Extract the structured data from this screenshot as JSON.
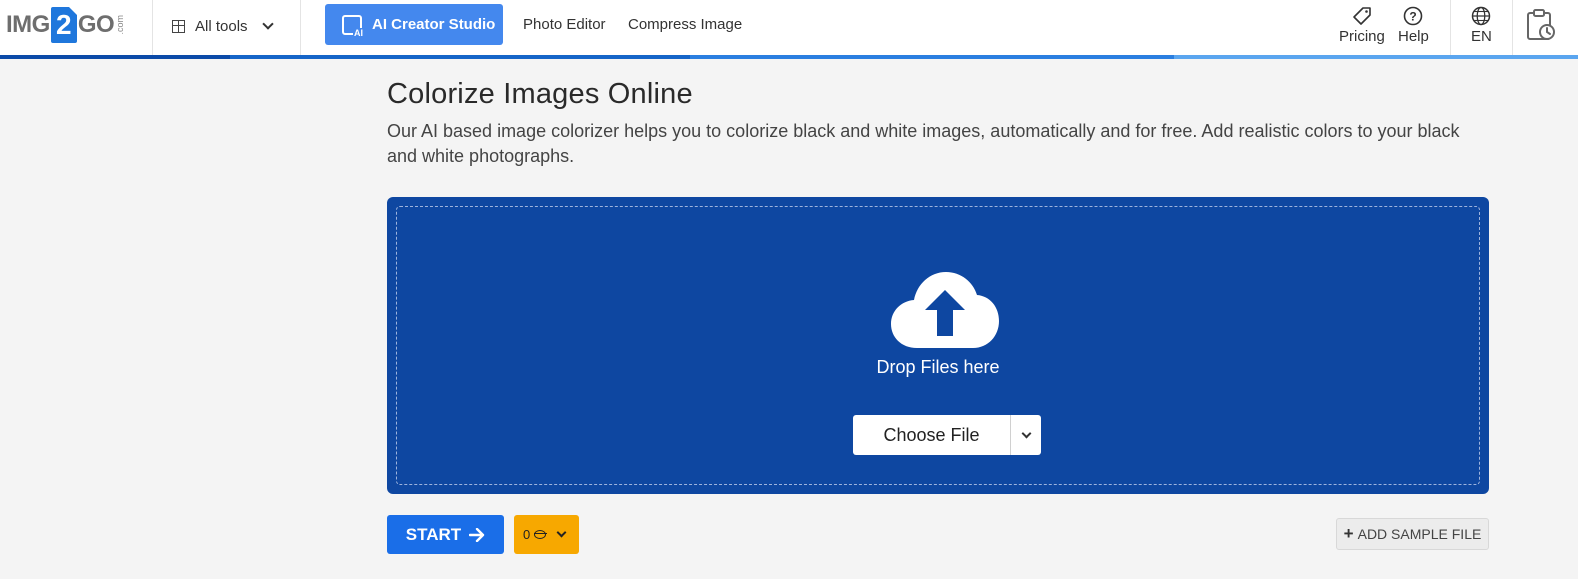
{
  "header": {
    "logo": {
      "left": "IMG",
      "middle": "2",
      "right": "GO",
      "suffix": ".com"
    },
    "all_tools": "All tools",
    "ai_creator": "AI Creator Studio",
    "nav": [
      "Photo Editor",
      "Compress Image"
    ],
    "pricing": "Pricing",
    "help": "Help",
    "language": "EN"
  },
  "main": {
    "title": "Colorize Images Online",
    "description": "Our AI based image colorizer helps you to colorize black and white images, automatically and for free. Add realistic colors to your black and white photographs.",
    "drop_text": "Drop Files here",
    "choose_file": "Choose File",
    "start": "START",
    "credits": "0",
    "add_sample": "ADD SAMPLE FILE"
  },
  "colors": {
    "dropzone": "#0e47a1",
    "start": "#1a6ee8",
    "credits": "#f7a800",
    "ai_button": "#4488ee"
  }
}
